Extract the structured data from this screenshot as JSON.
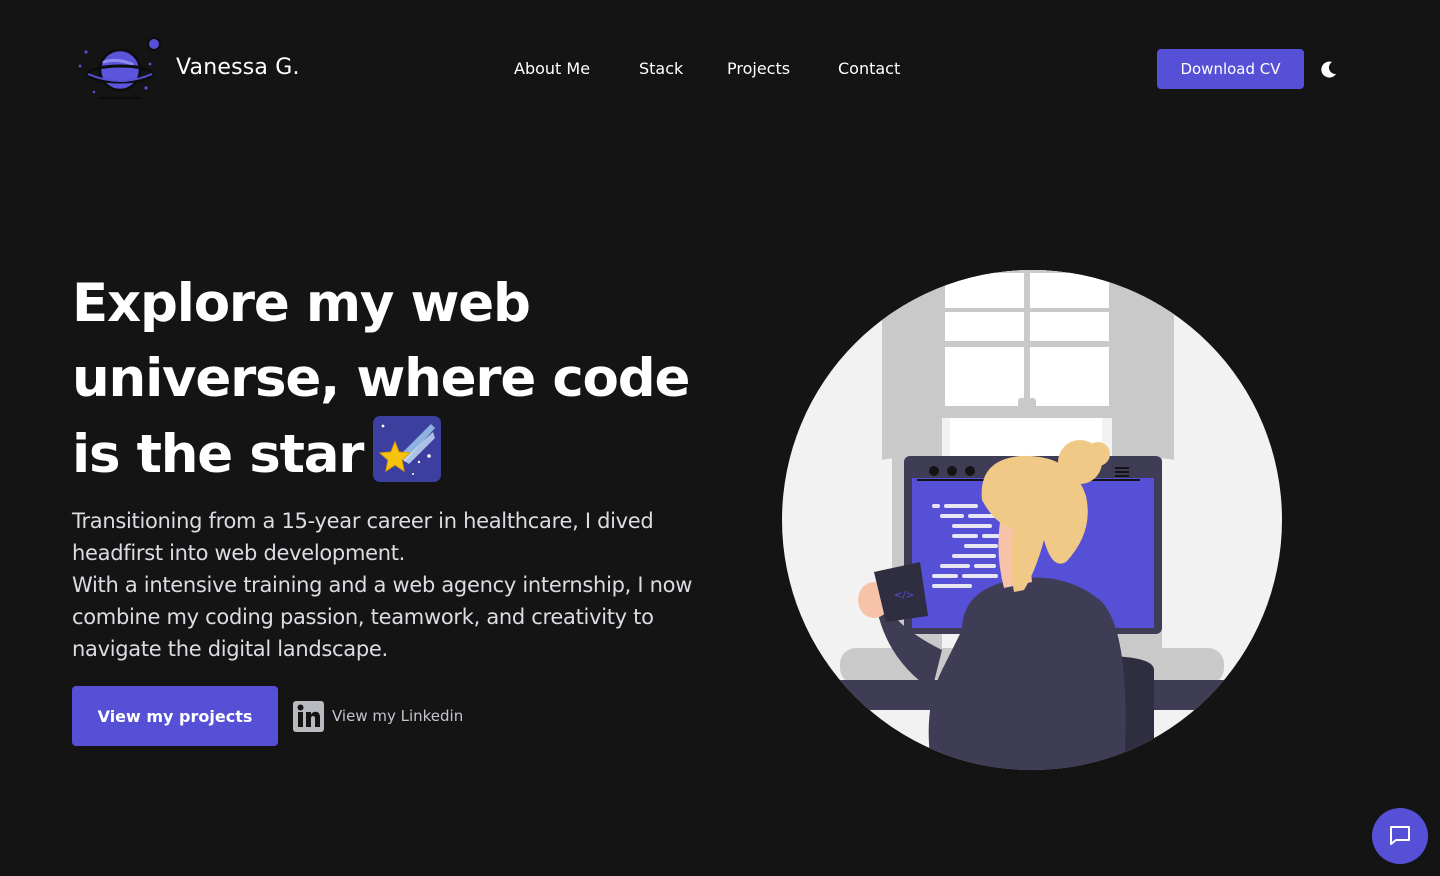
{
  "header": {
    "brand_name": "Vanessa G.",
    "logo_icon": "planet-logo-icon",
    "nav": [
      {
        "label": "About Me"
      },
      {
        "label": "Stack"
      },
      {
        "label": "Projects"
      },
      {
        "label": "Contact"
      }
    ],
    "download_cv_label": "Download CV",
    "theme_toggle_icon": "moon-icon"
  },
  "hero": {
    "title_text": "Explore my web universe, where code is the star",
    "title_emoji_icon": "shooting-star-icon",
    "description": [
      "Transitioning from a 15-year career in healthcare, I dived headfirst into web development.",
      "With a intensive training and a web agency internship, I now combine my coding passion, teamwork, and creativity to navigate the digital landscape."
    ],
    "primary_cta_label": "View my projects",
    "linkedin_label": "View my Linkedin",
    "linkedin_icon": "linkedin-icon"
  },
  "illustration": {
    "icon": "developer-at-computer-illustration",
    "screen_code_tag": "</>"
  },
  "chat": {
    "icon": "chat-bubble-icon"
  },
  "colors": {
    "background": "#141415",
    "accent": "#5650d6",
    "text": "#ffffff",
    "muted_text": "#dcdce2"
  }
}
